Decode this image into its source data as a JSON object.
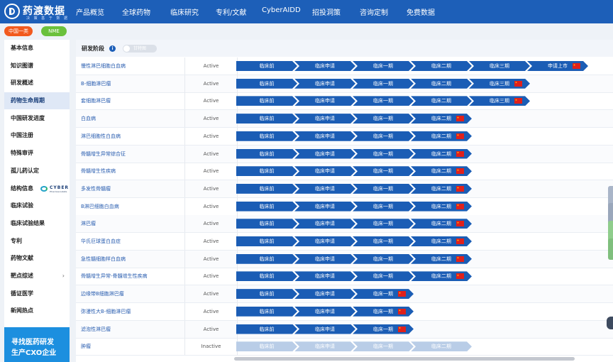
{
  "brand": {
    "name": "药渡数据",
    "sub": "决 策 基 于 数 据"
  },
  "nav": [
    "产品概览",
    "全球药物",
    "临床研究",
    "专利/文献",
    "CyberAIDD",
    "招投洞策",
    "咨询定制",
    "免费数据"
  ],
  "badges": [
    {
      "label": "中国一类",
      "color": "#f25a1e"
    },
    {
      "label": "NME",
      "color": "#6bc13c"
    }
  ],
  "sidebar": {
    "items": [
      {
        "label": "基本信息"
      },
      {
        "label": "知识图谱"
      },
      {
        "label": "研发概述"
      },
      {
        "label": "药物生命周期"
      },
      {
        "label": "中国研发进度"
      },
      {
        "label": "中国注册"
      },
      {
        "label": "特殊审评"
      },
      {
        "label": "孤儿药认定"
      },
      {
        "label": "结构信息"
      },
      {
        "label": "临床试验"
      },
      {
        "label": "临床试验结果"
      },
      {
        "label": "专利"
      },
      {
        "label": "药物文献"
      },
      {
        "label": "靶点综述"
      },
      {
        "label": "循证医学"
      },
      {
        "label": "新闻热点"
      }
    ],
    "active_index": 3,
    "cyber_logo": {
      "brand": "CYBER",
      "sub": "Pharmacodata"
    },
    "promo": [
      "寻找医药研发",
      "生产CXO企业"
    ]
  },
  "section": {
    "title": "研发阶段",
    "toggle_label": "甘特图"
  },
  "stage_names": [
    "临床前",
    "临床申请",
    "临床一期",
    "临床二期",
    "临床三期",
    "申请上市"
  ],
  "rows": [
    {
      "indication": "慢性淋巴细胞白血病",
      "status": "Active",
      "stages": 6
    },
    {
      "indication": "B-细胞淋巴瘤",
      "status": "Active",
      "stages": 5
    },
    {
      "indication": "套细胞淋巴瘤",
      "status": "Active",
      "stages": 5
    },
    {
      "indication": "白血病",
      "status": "Active",
      "stages": 4
    },
    {
      "indication": "淋巴细胞性白血病",
      "status": "Active",
      "stages": 4
    },
    {
      "indication": "骨髓增生异常综合征",
      "status": "Active",
      "stages": 4
    },
    {
      "indication": "骨髓增生性疾病",
      "status": "Active",
      "stages": 4
    },
    {
      "indication": "多发性骨髓瘤",
      "status": "Active",
      "stages": 4
    },
    {
      "indication": "B淋巴细胞白血病",
      "status": "Active",
      "stages": 4
    },
    {
      "indication": "淋巴瘤",
      "status": "Active",
      "stages": 4
    },
    {
      "indication": "华氏巨球蛋白血症",
      "status": "Active",
      "stages": 4
    },
    {
      "indication": "急性髓细胞样白血病",
      "status": "Active",
      "stages": 4
    },
    {
      "indication": "骨髓增生异常-骨髓增生性疾病",
      "status": "Active",
      "stages": 4
    },
    {
      "indication": "边缘带B细胞淋巴瘤",
      "status": "Active",
      "stages": 3
    },
    {
      "indication": "弥漫性大B-细胞淋巴瘤",
      "status": "Active",
      "stages": 3
    },
    {
      "indication": "滤泡性淋巴瘤",
      "status": "Active",
      "stages": 3
    },
    {
      "indication": "肿瘤",
      "status": "Inactive",
      "stages": 4
    }
  ],
  "colors": {
    "nav_bg": "#1d5fb8",
    "stage_active": "#1b5db5",
    "stage_inactive": "#b9cde7",
    "flag_red": "#e0201b",
    "right_tabs": [
      "#a9b5c8",
      "#9aa7bb",
      "#8fcd8c",
      "#7fbf7d"
    ]
  }
}
